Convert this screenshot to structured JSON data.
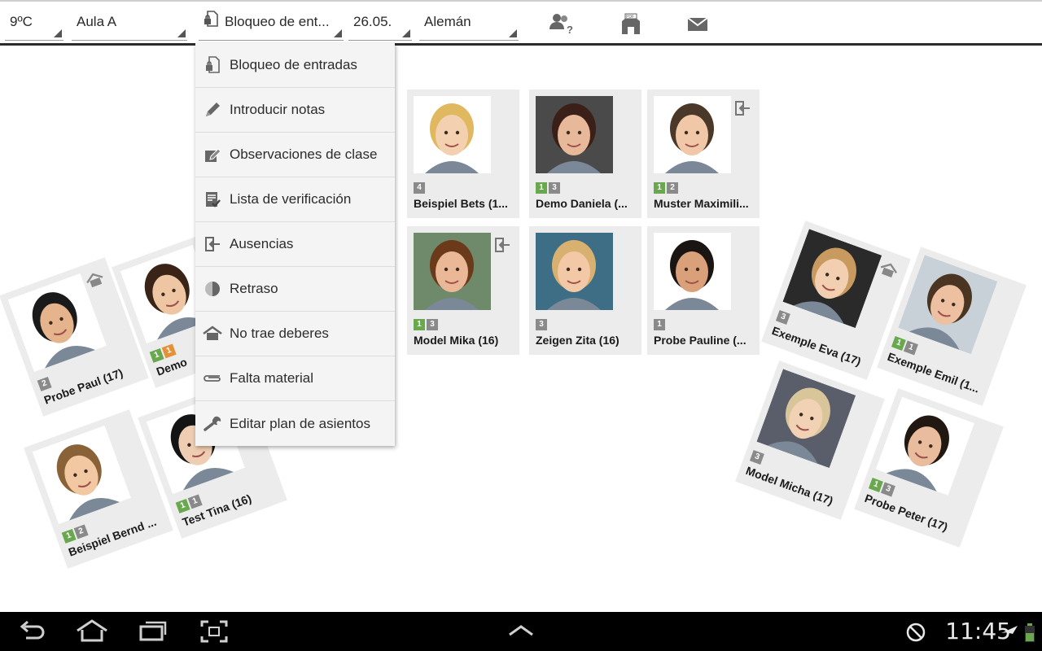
{
  "toolbar": {
    "temperature": "9ºC",
    "room": "Aula A",
    "mode": "Bloqueo de ent...",
    "date": "26.05.",
    "subject": "Alemán",
    "icons": [
      "users-question-icon",
      "school-pdf-icon",
      "mail-icon"
    ]
  },
  "menu": {
    "items": [
      {
        "label": "Bloqueo de entradas",
        "icon": "lock-document-icon"
      },
      {
        "label": "Introducir notas",
        "icon": "pencil-icon"
      },
      {
        "label": "Observaciones de clase",
        "icon": "edit-note-icon"
      },
      {
        "label": "Lista de verificación",
        "icon": "checklist-icon"
      },
      {
        "label": "Ausencias",
        "icon": "exit-door-icon"
      },
      {
        "label": "Retraso",
        "icon": "clock-pie-icon"
      },
      {
        "label": "No trae deberes",
        "icon": "house-icon"
      },
      {
        "label": "Falta material",
        "icon": "paperclip-icon"
      },
      {
        "label": "Editar plan de asientos",
        "icon": "wrench-icon"
      }
    ]
  },
  "students": [
    {
      "name": "Beispiel  Bets  (1...",
      "badges": [
        "4"
      ],
      "badge_colors": [
        "gray"
      ],
      "corner_icon": ""
    },
    {
      "name": "Demo Daniela  (...",
      "badges": [
        "1",
        "3"
      ],
      "badge_colors": [
        "green",
        "gray"
      ],
      "corner_icon": ""
    },
    {
      "name": "Muster Maximili...",
      "badges": [
        "1",
        "2"
      ],
      "badge_colors": [
        "green",
        "gray"
      ],
      "corner_icon": "exit-icon"
    },
    {
      "name": "Model Mika  (16)",
      "badges": [
        "1",
        "3"
      ],
      "badge_colors": [
        "green",
        "gray"
      ],
      "corner_icon": "exit-icon"
    },
    {
      "name": "Zeigen Zita  (16)",
      "badges": [
        "3"
      ],
      "badge_colors": [
        "gray"
      ],
      "corner_icon": ""
    },
    {
      "name": "Probe Pauline  (...",
      "badges": [
        "1"
      ],
      "badge_colors": [
        "gray"
      ],
      "corner_icon": ""
    },
    {
      "name": "Probe Paul  (17)",
      "badges": [
        "2"
      ],
      "badge_colors": [
        "gray"
      ],
      "corner_icon": "house-icon"
    },
    {
      "name": "Demo",
      "badges": [
        "1",
        "1"
      ],
      "badge_colors": [
        "green",
        "orange"
      ],
      "corner_icon": ""
    },
    {
      "name": "Beispiel  Bernd  ...",
      "badges": [
        "1",
        "2"
      ],
      "badge_colors": [
        "green",
        "gray"
      ],
      "corner_icon": ""
    },
    {
      "name": "Test Tina  (16)",
      "badges": [
        "1",
        "1"
      ],
      "badge_colors": [
        "green",
        "gray"
      ],
      "corner_icon": ""
    },
    {
      "name": "Exemple Eva  (17)",
      "badges": [
        "3"
      ],
      "badge_colors": [
        "gray"
      ],
      "corner_icon": "house-icon"
    },
    {
      "name": "Exemple Emil  (1...",
      "badges": [
        "1",
        "1"
      ],
      "badge_colors": [
        "green",
        "gray"
      ],
      "corner_icon": ""
    },
    {
      "name": "Model Micha  (17)",
      "badges": [
        "3"
      ],
      "badge_colors": [
        "gray"
      ],
      "corner_icon": ""
    },
    {
      "name": "Probe Peter  (17)",
      "badges": [
        "1",
        "3"
      ],
      "badge_colors": [
        "green",
        "gray"
      ],
      "corner_icon": ""
    }
  ],
  "statusbar": {
    "time": "11:45",
    "icons": [
      "back-icon",
      "home-icon",
      "recent-apps-icon",
      "screenshot-icon",
      "up-chevron-icon",
      "no-sync-icon",
      "airplane-icon",
      "battery-icon"
    ]
  },
  "colors": {
    "badge_green": "#6aa84f",
    "badge_orange": "#e69138",
    "badge_gray": "#8a8a8a",
    "card_bg": "#ececec"
  }
}
